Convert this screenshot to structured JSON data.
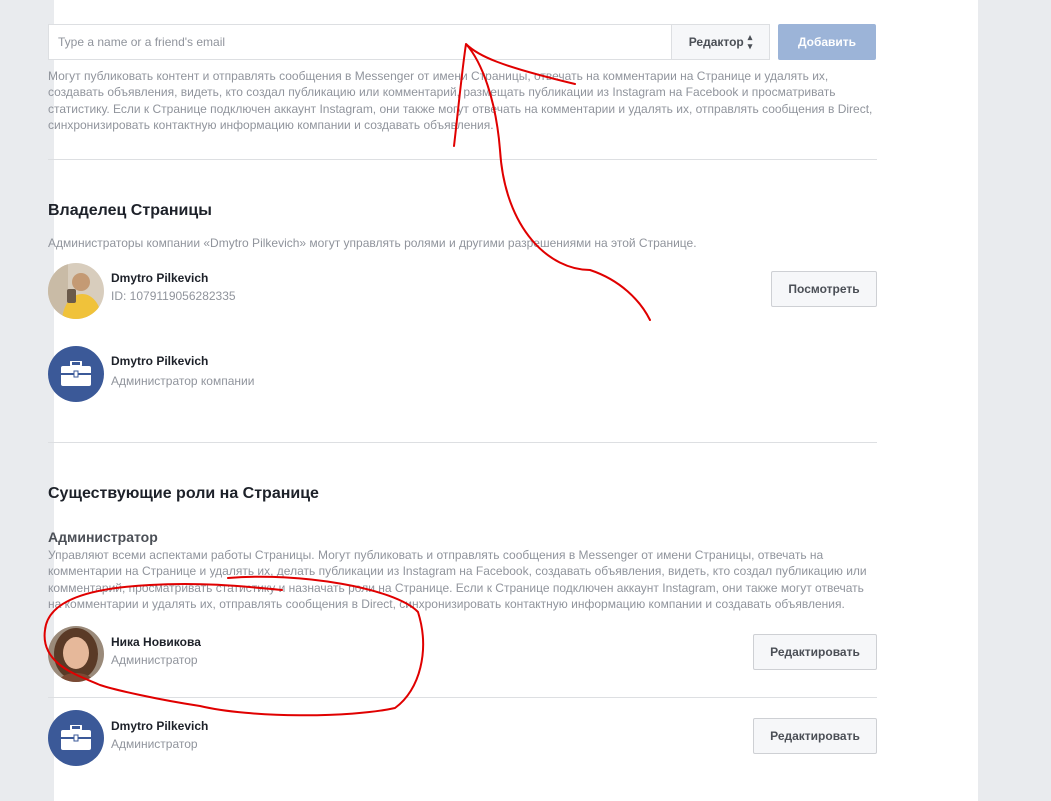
{
  "add_editor": {
    "input_placeholder": "Type a name or a friend's email",
    "role_select_value": "Редактор",
    "add_button_label": "Добавить",
    "description": "Могут публиковать контент и отправлять сообщения в Messenger от имени Страницы, отвечать на комментарии на Странице и удалять их, создавать объявления, видеть, кто создал публикацию или комментарий, размещать публикации из Instagram на Facebook и просматривать статистику. Если к Странице подключен аккаунт Instagram, они также могут отвечать на комментарии и удалять их, отправлять сообщения в Direct, синхронизировать контактную информацию компании и создавать объявления."
  },
  "page_owner": {
    "title": "Владелец Страницы",
    "description": "Администраторы компании «Dmytro Pilkevich» могут управлять ролями и другими разрешениями на этой Странице.",
    "people": [
      {
        "name": "Dmytro Pilkevich",
        "subtitle": "ID: 1079119056282335",
        "button": "Посмотреть",
        "avatar_icon": "user-photo"
      },
      {
        "name": "Dmytro Pilkevich",
        "subtitle": "Администратор компании",
        "avatar_icon": "briefcase-icon"
      }
    ]
  },
  "existing_roles": {
    "title": "Существующие роли на Странице",
    "admin_title": "Администратор",
    "admin_description": "Управляют всеми аспектами работы Страницы. Могут публиковать и отправлять сообщения в Messenger от имени Страницы, отвечать на комментарии на Странице и удалять их, делать публикации из Instagram на Facebook, создавать объявления, видеть, кто создал публикацию или комментарий, просматривать статистику и назначать роли на Странице. Если к Странице подключен аккаунт Instagram, они также могут отвечать на комментарии и удалять их, отправлять сообщения в Direct, синхронизировать контактную информацию компании и создавать объявления.",
    "people": [
      {
        "name": "Ника Новикова",
        "subtitle": "Администратор",
        "button": "Редактировать",
        "avatar_icon": "user-photo"
      },
      {
        "name": "Dmytro Pilkevich",
        "subtitle": "Администратор",
        "button": "Редактировать",
        "avatar_icon": "briefcase-icon"
      }
    ]
  },
  "colors": {
    "background": "#e9ebee",
    "brand_blue": "#3b5998",
    "disabled_button": "#9cb4d8",
    "annotation_red": "#e00000"
  }
}
